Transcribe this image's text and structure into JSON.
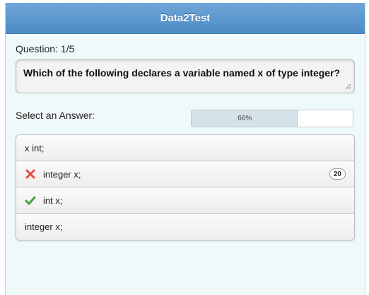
{
  "app": {
    "title": "Data2Test"
  },
  "question": {
    "counter": "Question: 1/5",
    "text": "Which of the following declares a variable named x of type integer?"
  },
  "answer_section": {
    "label": "Select an Answer:",
    "progress": {
      "fraction": 0.66,
      "text": "66%"
    }
  },
  "answers": [
    {
      "label": "x int;",
      "status": "none"
    },
    {
      "label": "integer x;",
      "status": "wrong",
      "icon": "x-mark-icon",
      "count": "20"
    },
    {
      "label": "int x;",
      "status": "correct",
      "icon": "checkmark-icon"
    },
    {
      "label": "integer x;",
      "status": "none"
    }
  ],
  "colors": {
    "header": "#5a97cf",
    "wrong": "#e84a4a",
    "correct": "#3ea33a",
    "background": "#f0f9fa"
  }
}
